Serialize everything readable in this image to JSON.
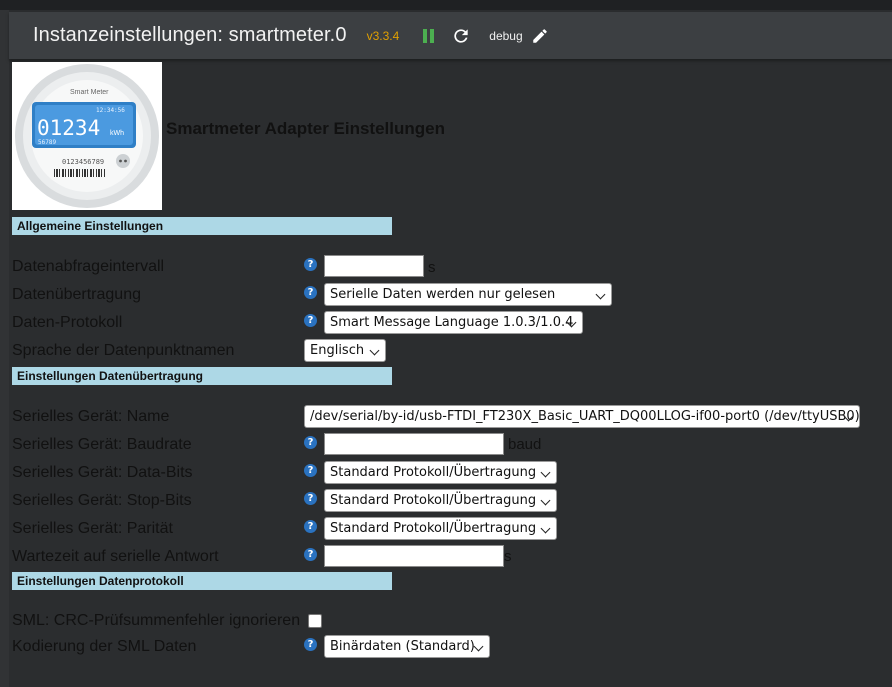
{
  "header": {
    "title": "Instanzeinstellungen: smartmeter.0",
    "version": "v3.3.4",
    "log_level": "debug",
    "accent_pause": "#4caf50",
    "accent_version": "#e0a000"
  },
  "logo": {
    "brand": "Smart Meter",
    "time": "12:34:56",
    "reading": "01234",
    "unit": "kWh",
    "sub": "56789",
    "serial": "0123456789"
  },
  "page_title": "Smartmeter Adapter Einstellungen",
  "sections": {
    "general": "Allgemeine Einstellungen",
    "transfer": "Einstellungen Datenübertragung",
    "protocol": "Einstellungen Datenprotokoll"
  },
  "fields": {
    "interval": {
      "label": "Datenabfrageintervall",
      "value": "",
      "unit": "s"
    },
    "transfer": {
      "label": "Datenübertragung",
      "selected": "Serielle Daten werden nur gelesen"
    },
    "protocol": {
      "label": "Daten-Protokoll",
      "selected": "Smart Message Language 1.0.3/1.0.4"
    },
    "language": {
      "label": "Sprache der Datenpunktnamen",
      "selected": "Englisch"
    },
    "serial_name": {
      "label": "Serielles Gerät: Name",
      "selected": "/dev/serial/by-id/usb-FTDI_FT230X_Basic_UART_DQ00LLOG-if00-port0 (/dev/ttyUSB0)"
    },
    "baudrate": {
      "label": "Serielles Gerät: Baudrate",
      "value": "",
      "unit": "baud"
    },
    "databits": {
      "label": "Serielles Gerät: Data-Bits",
      "selected": "Standard Protokoll/Übertragung"
    },
    "stopbits": {
      "label": "Serielles Gerät: Stop-Bits",
      "selected": "Standard Protokoll/Übertragung"
    },
    "parity": {
      "label": "Serielles Gerät: Parität",
      "selected": "Standard Protokoll/Übertragung"
    },
    "response_wait": {
      "label": "Wartezeit auf serielle Antwort",
      "value": "",
      "unit": "s"
    },
    "crc_ignore": {
      "label": "SML: CRC-Prüfsummenfehler ignorieren",
      "checked": false
    },
    "sml_encoding": {
      "label": "Kodierung der SML Daten",
      "selected": "Binärdaten (Standard)"
    }
  },
  "help_glyph": "?",
  "colors": {
    "section_bg": "#add8e6",
    "help_bg": "#2a72c0"
  }
}
